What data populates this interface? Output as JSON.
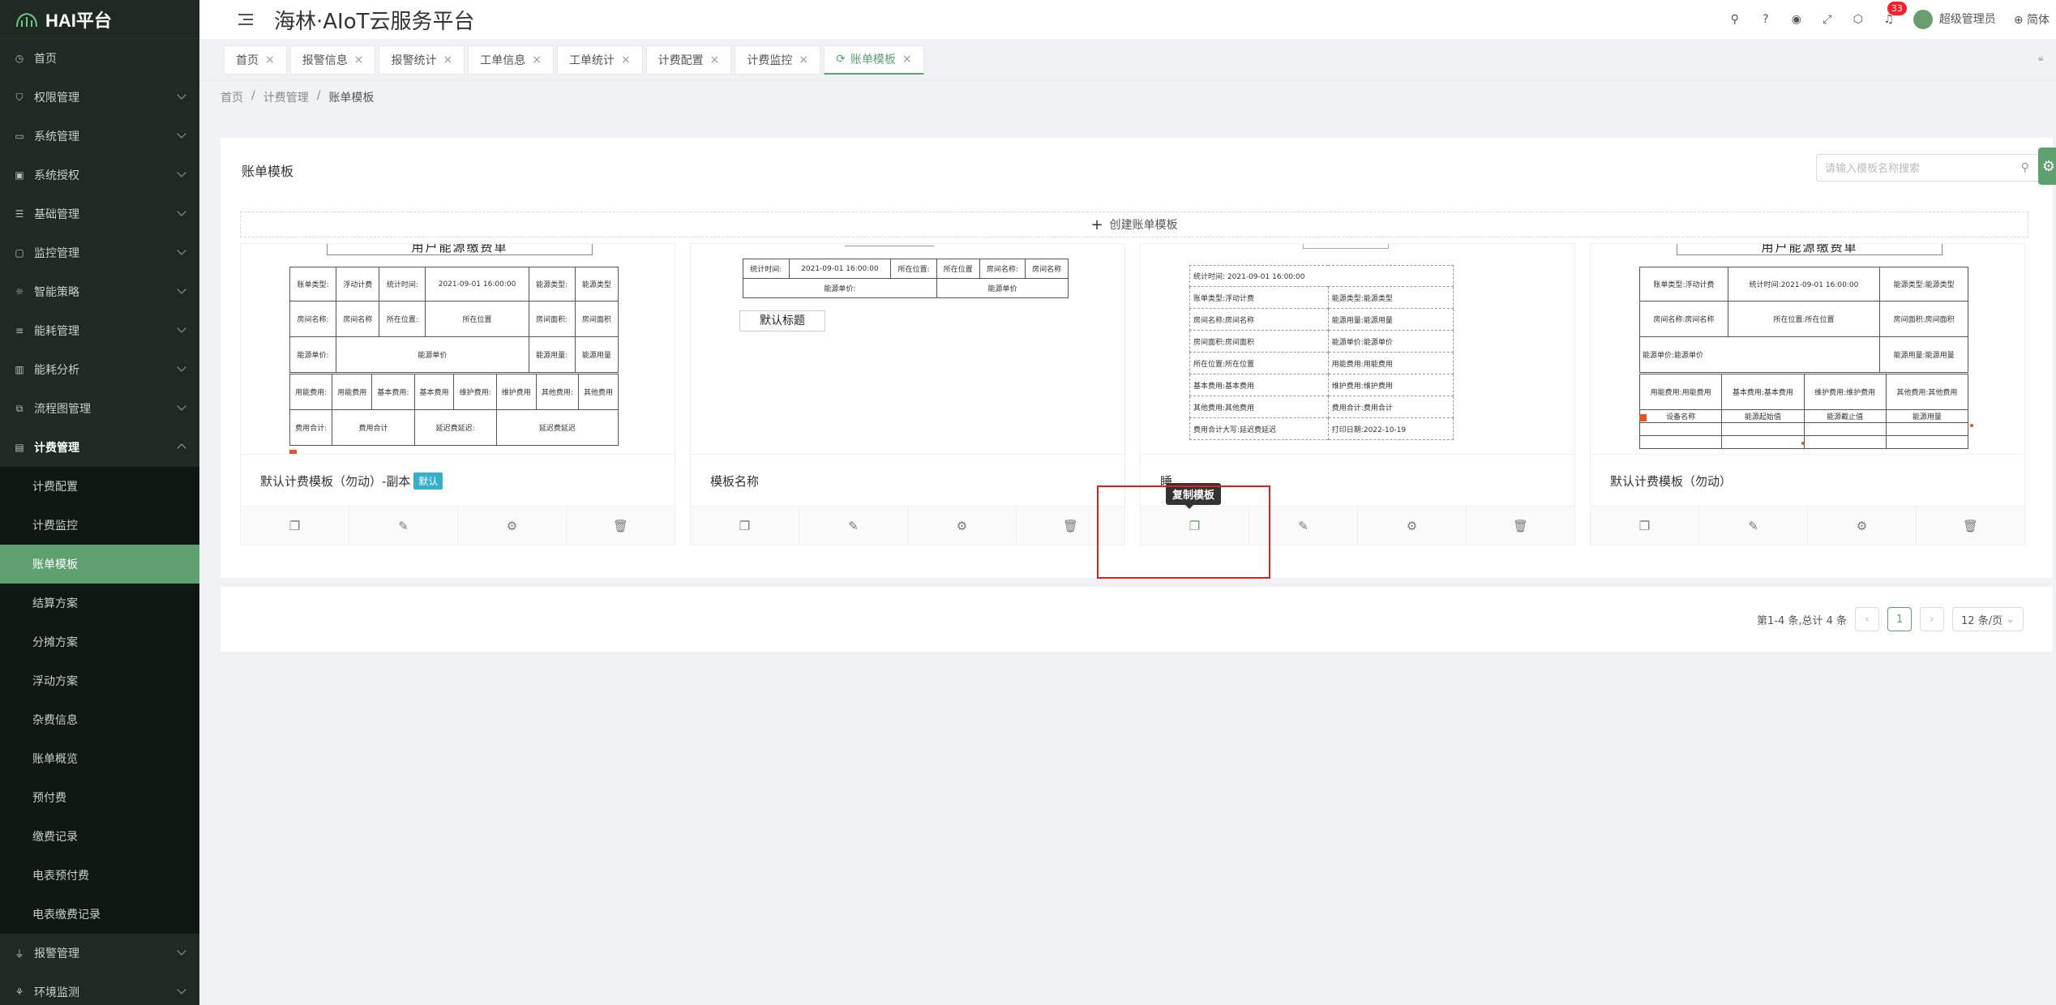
{
  "app": {
    "logo_text": "HAI平台",
    "title": "海林·AIoT云服务平台"
  },
  "header": {
    "notification_count": "33",
    "user": "超级管理员",
    "language": "简体"
  },
  "sidebar": {
    "items": [
      {
        "label": "首页"
      },
      {
        "label": "权限管理"
      },
      {
        "label": "系统管理"
      },
      {
        "label": "系统授权"
      },
      {
        "label": "基础管理"
      },
      {
        "label": "监控管理"
      },
      {
        "label": "智能策略"
      },
      {
        "label": "能耗管理"
      },
      {
        "label": "能耗分析"
      },
      {
        "label": "流程图管理"
      },
      {
        "label": "计费管理"
      }
    ],
    "sub_items": [
      {
        "label": "计费配置"
      },
      {
        "label": "计费监控"
      },
      {
        "label": "账单模板"
      },
      {
        "label": "结算方案"
      },
      {
        "label": "分摊方案"
      },
      {
        "label": "浮动方案"
      },
      {
        "label": "杂费信息"
      },
      {
        "label": "账单概览"
      },
      {
        "label": "预付费"
      },
      {
        "label": "缴费记录"
      },
      {
        "label": "电表预付费"
      },
      {
        "label": "电表缴费记录"
      }
    ],
    "after_items": [
      {
        "label": "报警管理"
      },
      {
        "label": "环境监测"
      }
    ]
  },
  "tabs": [
    {
      "label": "首页"
    },
    {
      "label": "报警信息"
    },
    {
      "label": "报警统计"
    },
    {
      "label": "工单信息"
    },
    {
      "label": "工单统计"
    },
    {
      "label": "计费配置"
    },
    {
      "label": "计费监控"
    },
    {
      "label": "账单模板"
    }
  ],
  "breadcrumb": [
    "首页",
    "计费管理",
    "账单模板"
  ],
  "main": {
    "title": "账单模板",
    "search_placeholder": "请输入模板名称搜索",
    "create_label": "创建账单模板",
    "tooltip": "复制模板",
    "cards": [
      {
        "name": "默认计费模板（勿动）-副本",
        "badge": "默认",
        "preview_title": "用户能源缴费单"
      },
      {
        "name": "模板名称",
        "preview_title": "默认标题"
      },
      {
        "name": "睡"
      },
      {
        "name": "默认计费模板（勿动）",
        "preview_title": "用户能源缴费单"
      }
    ]
  },
  "preview1": {
    "r1": [
      "账单类型:",
      "浮动计费",
      "统计时间:",
      "2021-09-01 16:00:00",
      "能源类型:",
      "能源类型"
    ],
    "r2": [
      "房间名称:",
      "房间名称",
      "所在位置:",
      "所在位置",
      "房间面积:",
      "房间面积"
    ],
    "r3": [
      "能源单价:",
      "能源单价",
      "能源用量:",
      "能源用量"
    ],
    "r4": [
      "用能费用:",
      "用能费用",
      "基本费用:",
      "基本费用",
      "维护费用:",
      "维护费用",
      "其他费用:",
      "其他费用"
    ],
    "r5": [
      "费用合计:",
      "费用合计",
      "延迟费延迟:",
      "延迟费延迟"
    ]
  },
  "preview2": {
    "r1": [
      "统计时间:",
      "2021-09-01 16:00:00",
      "所在位置:",
      "所在位置",
      "房间名称:",
      "房间名称"
    ],
    "r2": [
      "能源单价:",
      "能源单价"
    ]
  },
  "preview3": {
    "r0": [
      "统计时间:",
      "2021-09-01 16:00:00"
    ],
    "rows": [
      [
        "账单类型:",
        "浮动计费",
        "能源类型:",
        "能源类型"
      ],
      [
        "房间名称:",
        "房间名称",
        "能源用量:",
        "能源用量"
      ],
      [
        "房间面积:",
        "房间面积",
        "能源单价:",
        "能源单价"
      ],
      [
        "所在位置:",
        "所在位置",
        "用能费用:",
        "用能费用"
      ],
      [
        "基本费用:",
        "基本费用",
        "维护费用:",
        "维护费用"
      ],
      [
        "其他费用:",
        "其他费用",
        "费用合计:",
        "费用合计"
      ],
      [
        "费用合计大写:",
        "延迟费延迟",
        "打印日期:",
        "2022-10-19"
      ]
    ]
  },
  "preview4": {
    "r1": [
      "账单类型:",
      "浮动计费",
      "统计时间:",
      "2021-09-01 16:00:00",
      "能源类型:",
      "能源类型"
    ],
    "r2": [
      "房间名称:",
      "房间名称",
      "所在位置:",
      "所在位置",
      "房间面积:",
      "房间面积"
    ],
    "r3": [
      "能源单价:",
      "能源单价",
      "能源用量:",
      "能源用量"
    ],
    "r4": [
      "用能费用:",
      "用能费用",
      "基本费用:",
      "基本费用",
      "维护费用:",
      "维护费用",
      "其他费用:",
      "其他费用"
    ],
    "r5": [
      "设备名称",
      "能源起始值",
      "能源截止值",
      "能源用量"
    ]
  },
  "pagination": {
    "summary": "第1-4 条,总计 4 条",
    "current": "1",
    "page_size": "12 条/页"
  }
}
